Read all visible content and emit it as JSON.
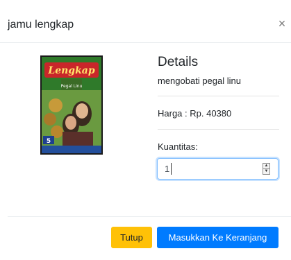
{
  "modal": {
    "title": "jamu lengkap",
    "close_symbol": "×"
  },
  "product": {
    "image_icon": "product-package-image",
    "image_text": "Lengkap",
    "image_subtext": "Pegal Linu",
    "details_heading": "Details",
    "description": "mengobati pegal linu",
    "price_label": "Harga : Rp. 40380",
    "quantity_label": "Kuantitas:",
    "quantity_value": "1"
  },
  "footer": {
    "close_label": "Tutup",
    "add_to_cart_label": "Masukkan Ke Keranjang"
  },
  "colors": {
    "close_button": "#ffc107",
    "cart_button": "#007bff",
    "input_focus_border": "#80bdff"
  }
}
